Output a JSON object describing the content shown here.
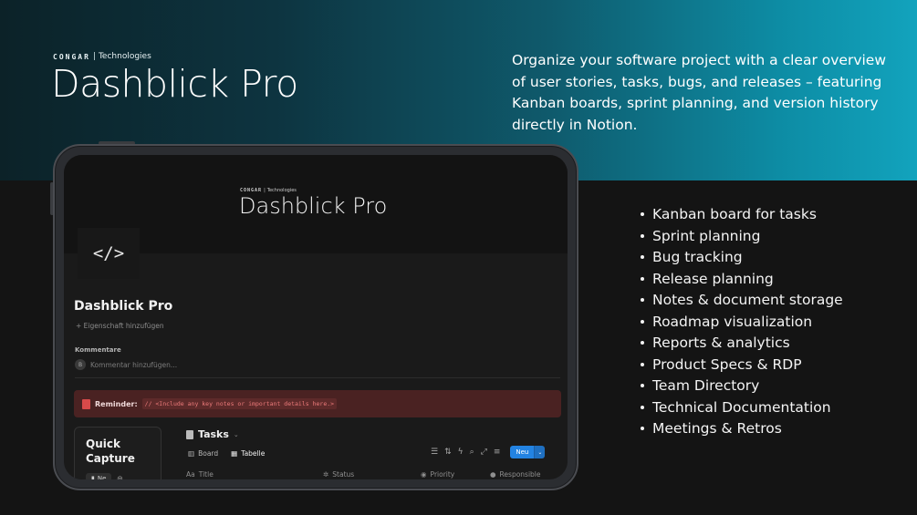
{
  "hero": {
    "brand_logo": "CONGAR",
    "brand_suffix": "Technologies",
    "title": "Dashblick Pro",
    "description": "Organize your software project with a clear overview of user stories, tasks, bugs, and releases – featuring Kanban boards, sprint planning, and version history directly in Notion."
  },
  "notion_page": {
    "cover_brand_logo": "CONGAR",
    "cover_brand_suffix": "Technologies",
    "cover_title": "Dashblick Pro",
    "page_icon": "</>",
    "page_title": "Dashblick Pro",
    "add_property": "Eigenschaft hinzufügen",
    "comments_label": "Kommentare",
    "comment_avatar": "B",
    "comment_placeholder": "Kommentar hinzufügen...",
    "reminder_label": "Reminder:",
    "reminder_code": "// <Include any key notes or important details here.>",
    "quick_capture_title": "Quick Capture",
    "quick_capture_button": "Ne",
    "database_title": "Tasks",
    "views": [
      {
        "label": "Board",
        "icon": "board-icon"
      },
      {
        "label": "Tabelle",
        "icon": "table-icon"
      }
    ],
    "new_button": "Neu",
    "columns": [
      {
        "label": "Title",
        "icon": "Aa"
      },
      {
        "label": "Status",
        "icon": "status-icon"
      },
      {
        "label": "Priority",
        "icon": "priority-icon"
      },
      {
        "label": "Responsible",
        "icon": "person-icon"
      }
    ],
    "colors": {
      "reminder_bg": "#4a2222",
      "accent_blue": "#2383e2"
    }
  },
  "features": [
    "Kanban board for tasks",
    "Sprint planning",
    "Bug tracking",
    "Release planning",
    "Notes & document storage",
    "Roadmap visualization",
    "Reports & analytics",
    "Product Specs & RDP",
    "Team Directory",
    "Technical Documentation",
    "Meetings & Retros"
  ]
}
